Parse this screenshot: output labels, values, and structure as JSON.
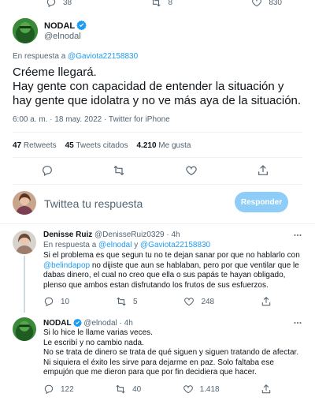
{
  "top_actions": {
    "replies": "38",
    "retweets": "8",
    "likes": "830"
  },
  "main_tweet": {
    "name": "NODAL",
    "handle": "@elnodal",
    "reply_prefix": "En respuesta a",
    "reply_to": "@Gaviota22158830",
    "text_line1": "Créeme llegará.",
    "text_line2": "Hay gente con capacidad de entender la situación y hay gente que idolatra y no ve más aya de la situación.",
    "meta": "6:00 a. m. · 18 may. 2022 · Twitter for iPhone",
    "stats": {
      "retweets_count": "47",
      "retweets_label": "Retweets",
      "quotes_count": "45",
      "quotes_label": "Tweets citados",
      "likes_count": "4.210",
      "likes_label": "Me gusta"
    }
  },
  "compose": {
    "placeholder": "Twittea tu respuesta",
    "button": "Responder"
  },
  "reply1": {
    "name": "Denisse Ruiz",
    "handle": "@DenisseRuiz0329",
    "time": "4h",
    "reply_prefix": "En respuesta a",
    "reply_to_1": "@elnodal",
    "reply_and": "y",
    "reply_to_2": "@Gaviota22158830",
    "text_a": "Si el problema es que segun tu no te dejan sanar por que no hablarlo con",
    "mention": "@belindapop",
    "text_b": "no dijiste que aun se hablaban, pero por que ventilar que le dabas dinero, el cual no creo que ella o sus papás te hayan obligado, plenso que ambos estan disfrutando los frutos de sus esfuerzos.",
    "replies": "10",
    "retweets": "5",
    "likes": "248"
  },
  "reply2": {
    "name": "NODAL",
    "handle": "@elnodal",
    "time": "4h",
    "line1": "Si lo hice le llame varias veces.",
    "line2": "Le escribí y no cambio nada.",
    "line3": "No se trata de dinero se trata de qué siguen y siguen tratando de afectar.",
    "line4": "Ni siquiera el éxito les sirve para dejarme en paz. Solo faltaba ese empujón que me dieron para que por fin decidiera que hacer.",
    "replies": "122",
    "retweets": "40",
    "likes": "1.418"
  },
  "colors": {
    "accent": "#1d9bf0",
    "muted": "#536471",
    "divider": "#eff3f4",
    "button_disabled": "#8ecdf8"
  }
}
